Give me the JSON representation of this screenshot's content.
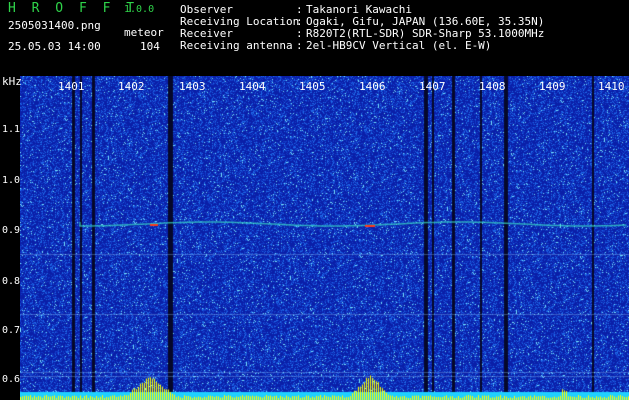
{
  "header": {
    "app_title": "H R O F F T",
    "app_version": "1.0.0",
    "file_name": "2505031400.png",
    "mode": "meteor",
    "datetime": "25.05.03 14:00",
    "count": "104",
    "info": [
      {
        "label": "Observer",
        "value": "Takanori Kawachi"
      },
      {
        "label": "Receiving Location",
        "value": "Ogaki, Gifu, JAPAN (136.60E, 35.35N)"
      },
      {
        "label": "Receiver",
        "value": "R820T2(RTL-SDR) SDR-Sharp 53.1000MHz"
      },
      {
        "label": "Receiving antenna",
        "value": "2el-HB9CV Vertical (el. E-W)"
      }
    ]
  },
  "spectrogram": {
    "y_unit": "kHz",
    "y_ticks": [
      "1.1",
      "1.0",
      "0.9",
      "0.8",
      "0.7",
      "0.6"
    ],
    "x_ticks": [
      "1401",
      "1402",
      "1403",
      "1404",
      "1405",
      "1406",
      "1407",
      "1408",
      "1409",
      "1410"
    ],
    "colors": {
      "background": "#0a1fa8",
      "noise": "#1f6ae8",
      "signal": "#38e0c8",
      "echo": "#ff3a1a",
      "power": "#ffff00",
      "floor": "#1fd0ff"
    }
  }
}
